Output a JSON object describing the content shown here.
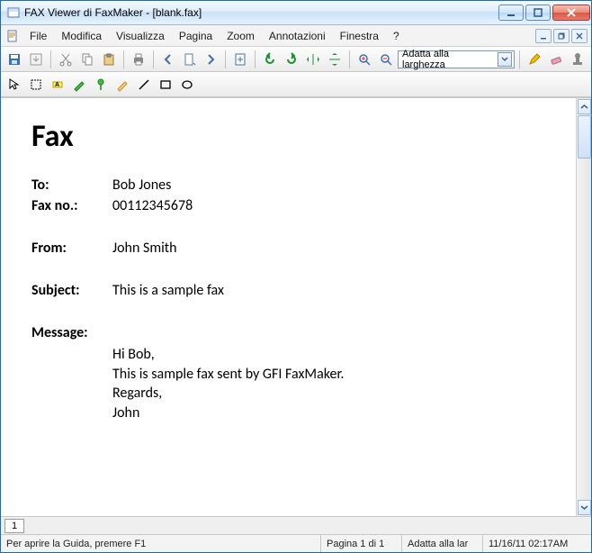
{
  "window": {
    "title": "FAX Viewer di FaxMaker - [blank.fax]"
  },
  "menu": {
    "file": "File",
    "edit": "Modifica",
    "view": "Visualizza",
    "page": "Pagina",
    "zoom": "Zoom",
    "annot": "Annotazioni",
    "window": "Finestra",
    "help": "?"
  },
  "toolbar": {
    "zoom_combo": "Adatta alla larghezza"
  },
  "document": {
    "heading": "Fax",
    "labels": {
      "to": "To:",
      "faxno": "Fax no.:",
      "from": "From:",
      "subject": "Subject:",
      "message": "Message:"
    },
    "to": "Bob Jones",
    "faxno": "00112345678",
    "from": "John Smith",
    "subject": "This is a sample fax",
    "message_lines": {
      "l1": "Hi Bob,",
      "l2": "This is sample fax sent by GFI FaxMaker.",
      "l3": "Regards,",
      "l4": "John"
    }
  },
  "tabs": {
    "page1": "1"
  },
  "status": {
    "help": "Per aprire la Guida, premere F1",
    "page": "Pagina 1 di 1",
    "zoom": "Adatta alla lar",
    "datetime": "11/16/11 02:17AM"
  }
}
